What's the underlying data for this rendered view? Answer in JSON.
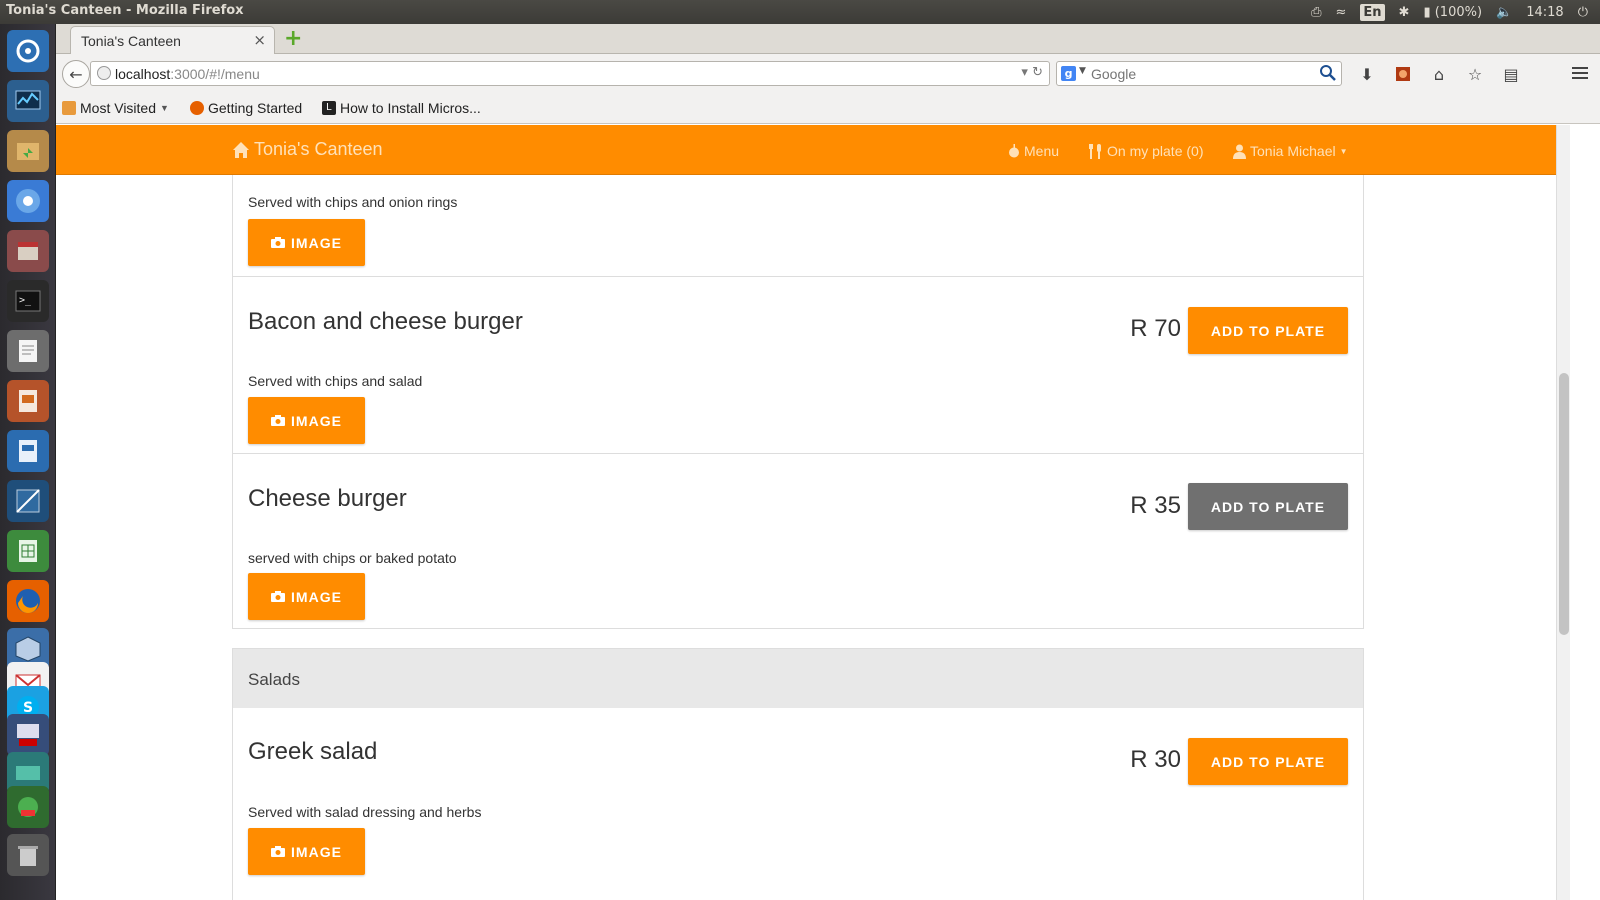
{
  "os": {
    "window_title": "Tonia's Canteen - Mozilla Firefox",
    "keyboard_layout": "En",
    "battery": "(100%)",
    "clock": "14:18"
  },
  "browser": {
    "tab_title": "Tonia's Canteen",
    "tab_close": "×",
    "new_tab": "+",
    "url_host": "localhost",
    "url_rest": ":3000/#!/menu",
    "search_placeholder": "Google",
    "bookmarks": [
      "Most Visited",
      "Getting Started",
      "How to Install Micros..."
    ]
  },
  "app": {
    "brand": "Tonia's Canteen",
    "nav_menu": "Menu",
    "nav_plate": "On my plate (0)",
    "nav_user": "Tonia Michael"
  },
  "prev_item": {
    "desc": "Served with chips and onion rings",
    "image_label": "IMAGE"
  },
  "items": [
    {
      "name": "Bacon and cheese burger",
      "price": "R 70",
      "desc": "Served with chips and salad",
      "add_label": "ADD TO PLATE",
      "image_label": "IMAGE"
    },
    {
      "name": "Cheese burger",
      "price": "R 35",
      "desc": "served with chips or baked potato",
      "add_label": "ADD TO PLATE",
      "image_label": "IMAGE"
    }
  ],
  "section": {
    "title": "Salads"
  },
  "salad_items": [
    {
      "name": "Greek salad",
      "price": "R 30",
      "desc": "Served with salad dressing and herbs",
      "add_label": "ADD TO PLATE",
      "image_label": "IMAGE"
    }
  ],
  "colors": {
    "accent": "#ff8c00",
    "active_button": "#707070"
  }
}
